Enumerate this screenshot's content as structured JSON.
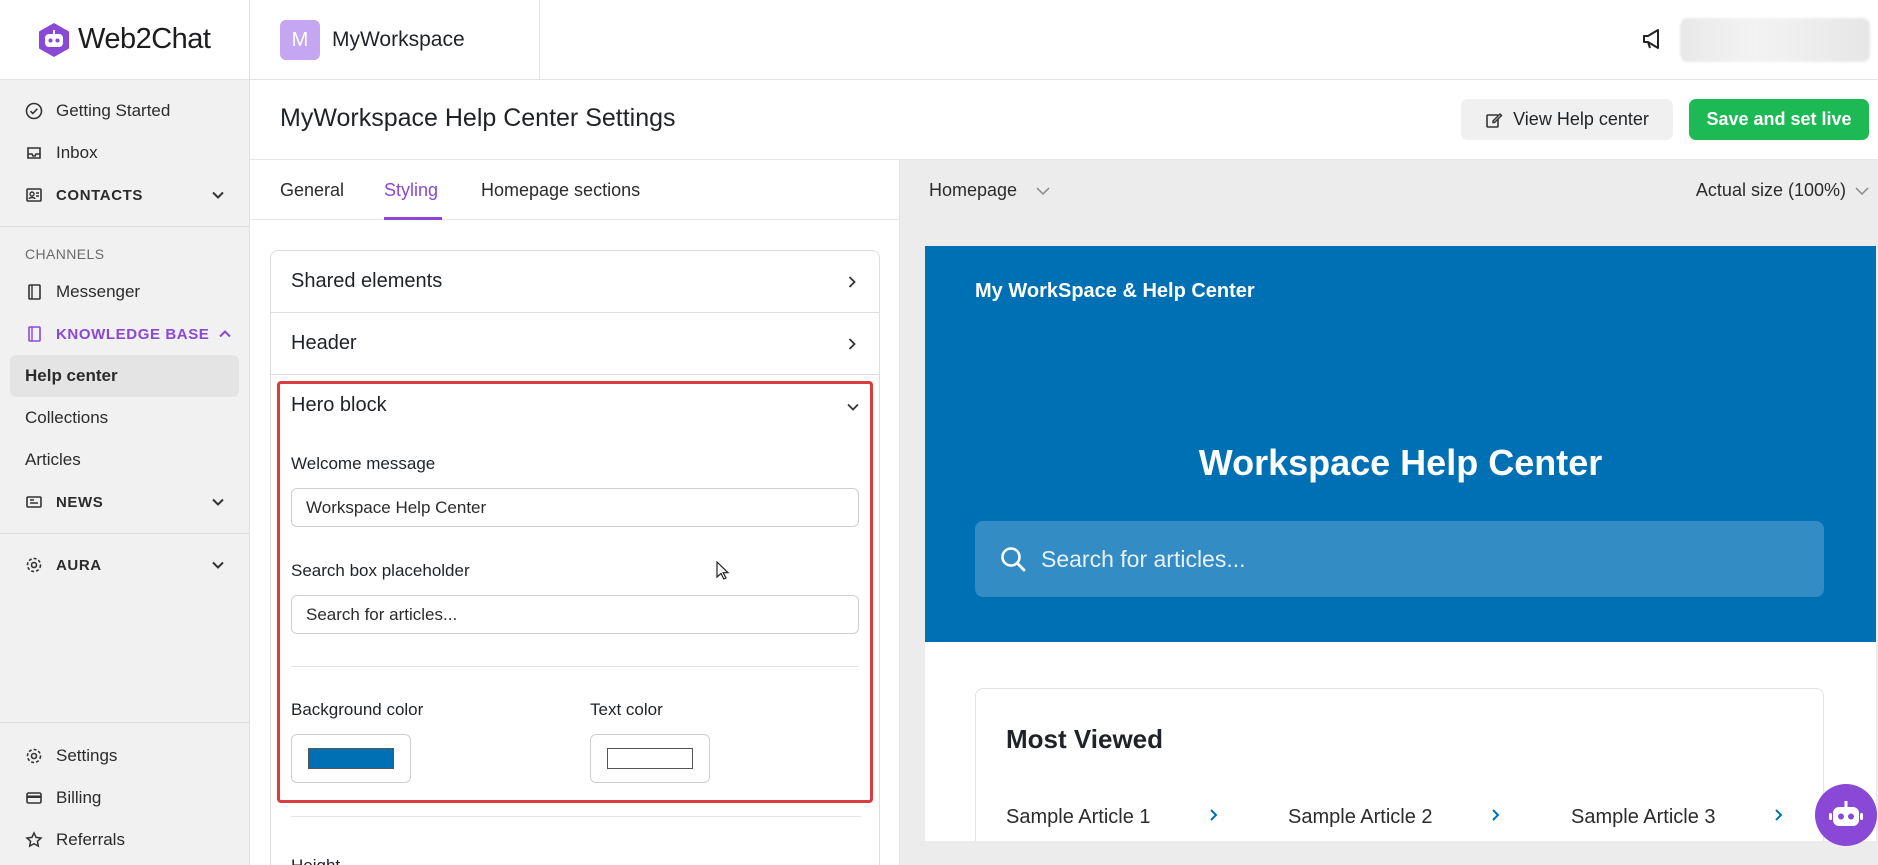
{
  "app": {
    "name": "Web2Chat"
  },
  "workspace": {
    "avatar_letter": "M",
    "name": "MyWorkspace"
  },
  "sidebar": {
    "items": [
      {
        "label": "Getting Started"
      },
      {
        "label": "Inbox"
      },
      {
        "label": "CONTACTS"
      }
    ],
    "channels_label": "CHANNELS",
    "channels": [
      {
        "label": "Messenger"
      },
      {
        "label": "KNOWLEDGE BASE"
      }
    ],
    "knowledge_base_sub": [
      {
        "label": "Help center"
      },
      {
        "label": "Collections"
      },
      {
        "label": "Articles"
      }
    ],
    "news_label": "NEWS",
    "aura_label": "AURA",
    "bottom": [
      {
        "label": "Settings"
      },
      {
        "label": "Billing"
      },
      {
        "label": "Referrals"
      }
    ]
  },
  "header": {
    "title": "MyWorkspace Help Center Settings",
    "view_button": "View Help center",
    "save_button": "Save and set live"
  },
  "tabs": [
    {
      "label": "General"
    },
    {
      "label": "Styling"
    },
    {
      "label": "Homepage sections"
    }
  ],
  "styling": {
    "shared_elements": "Shared elements",
    "header_section": "Header",
    "hero_block": {
      "title": "Hero block",
      "welcome_label": "Welcome message",
      "welcome_value": "Workspace Help Center",
      "search_label": "Search box placeholder",
      "search_value": "Search for articles...",
      "bg_color_label": "Background color",
      "bg_color": "#0070b5",
      "text_color_label": "Text color",
      "text_color": "#ffffff"
    },
    "height_label": "Height"
  },
  "preview": {
    "page_select": "Homepage",
    "zoom": "Actual size (100%)",
    "brand": "My WorkSpace & Help Center",
    "welcome": "Workspace Help Center",
    "search_placeholder": "Search for articles...",
    "most_viewed_title": "Most Viewed",
    "articles": [
      {
        "title": "Sample Article 1"
      },
      {
        "title": "Sample Article 2"
      },
      {
        "title": "Sample Article 3"
      }
    ]
  },
  "colors": {
    "accent": "#8a48d6",
    "save": "#1db954",
    "highlight": "#dc3b3f"
  }
}
